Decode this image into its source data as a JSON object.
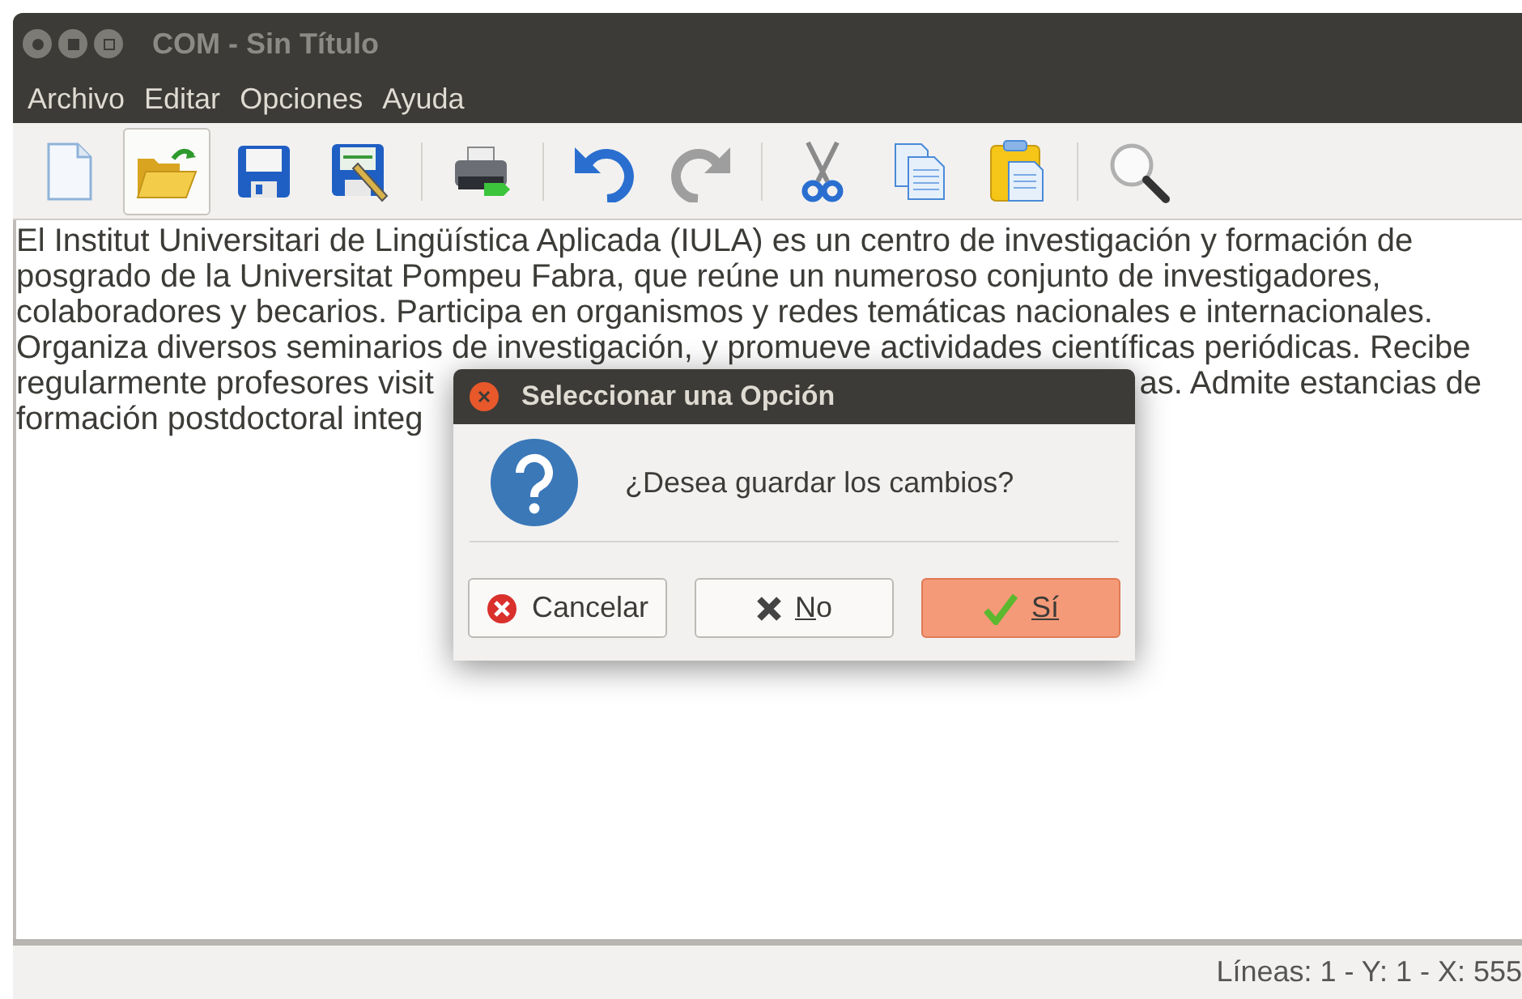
{
  "window": {
    "title": "COM - Sin Título",
    "active": false
  },
  "menu": [
    "Archivo",
    "Editar",
    "Opciones",
    "Ayuda"
  ],
  "toolbar": [
    {
      "kind": "new",
      "highlighted": false,
      "disabled": false
    },
    {
      "kind": "open",
      "highlighted": true,
      "disabled": false
    },
    {
      "kind": "save",
      "highlighted": false,
      "disabled": false
    },
    {
      "kind": "save-as",
      "highlighted": false,
      "disabled": false
    },
    {
      "kind": "separator"
    },
    {
      "kind": "print",
      "highlighted": false,
      "disabled": false
    },
    {
      "kind": "separator"
    },
    {
      "kind": "undo",
      "highlighted": false,
      "disabled": false
    },
    {
      "kind": "redo",
      "highlighted": false,
      "disabled": true
    },
    {
      "kind": "separator"
    },
    {
      "kind": "cut",
      "highlighted": false,
      "disabled": false
    },
    {
      "kind": "copy",
      "highlighted": false,
      "disabled": false
    },
    {
      "kind": "paste",
      "highlighted": false,
      "disabled": false
    },
    {
      "kind": "separator"
    },
    {
      "kind": "find",
      "highlighted": false,
      "disabled": false
    }
  ],
  "editor": {
    "lines": [
      {
        "left": "El Institut Universitari de Lingüística Aplicada (IULA) es un centro de investigación y formación de"
      },
      {
        "left": "posgrado de la Universitat Pompeu Fabra, que reúne un numeroso conjunto de investigadores,"
      },
      {
        "left": "colaboradores y becarios. Participa en organismos y redes temáticas nacionales e internacionales."
      },
      {
        "left": "Organiza diversos seminarios de investigación, y promueve actividades científicas periódicas. Recibe"
      },
      {
        "left": "regularmente profesores visit",
        "right": "as. Admite estancias de"
      },
      {
        "left": "formación postdoctoral integ"
      }
    ]
  },
  "dialog": {
    "title": "Seleccionar una Opción",
    "message": "¿Desea guardar los cambios?",
    "buttons": [
      {
        "kind": "cancel",
        "label_rest": "Cancelar",
        "default": false
      },
      {
        "kind": "no",
        "label_mnemonic": "N",
        "label_rest": "o",
        "default": false
      },
      {
        "kind": "yes",
        "label_mnemonic": "Sí",
        "default": true
      }
    ]
  },
  "status_bar": "Líneas: 1 - Y: 1 - X: 555"
}
